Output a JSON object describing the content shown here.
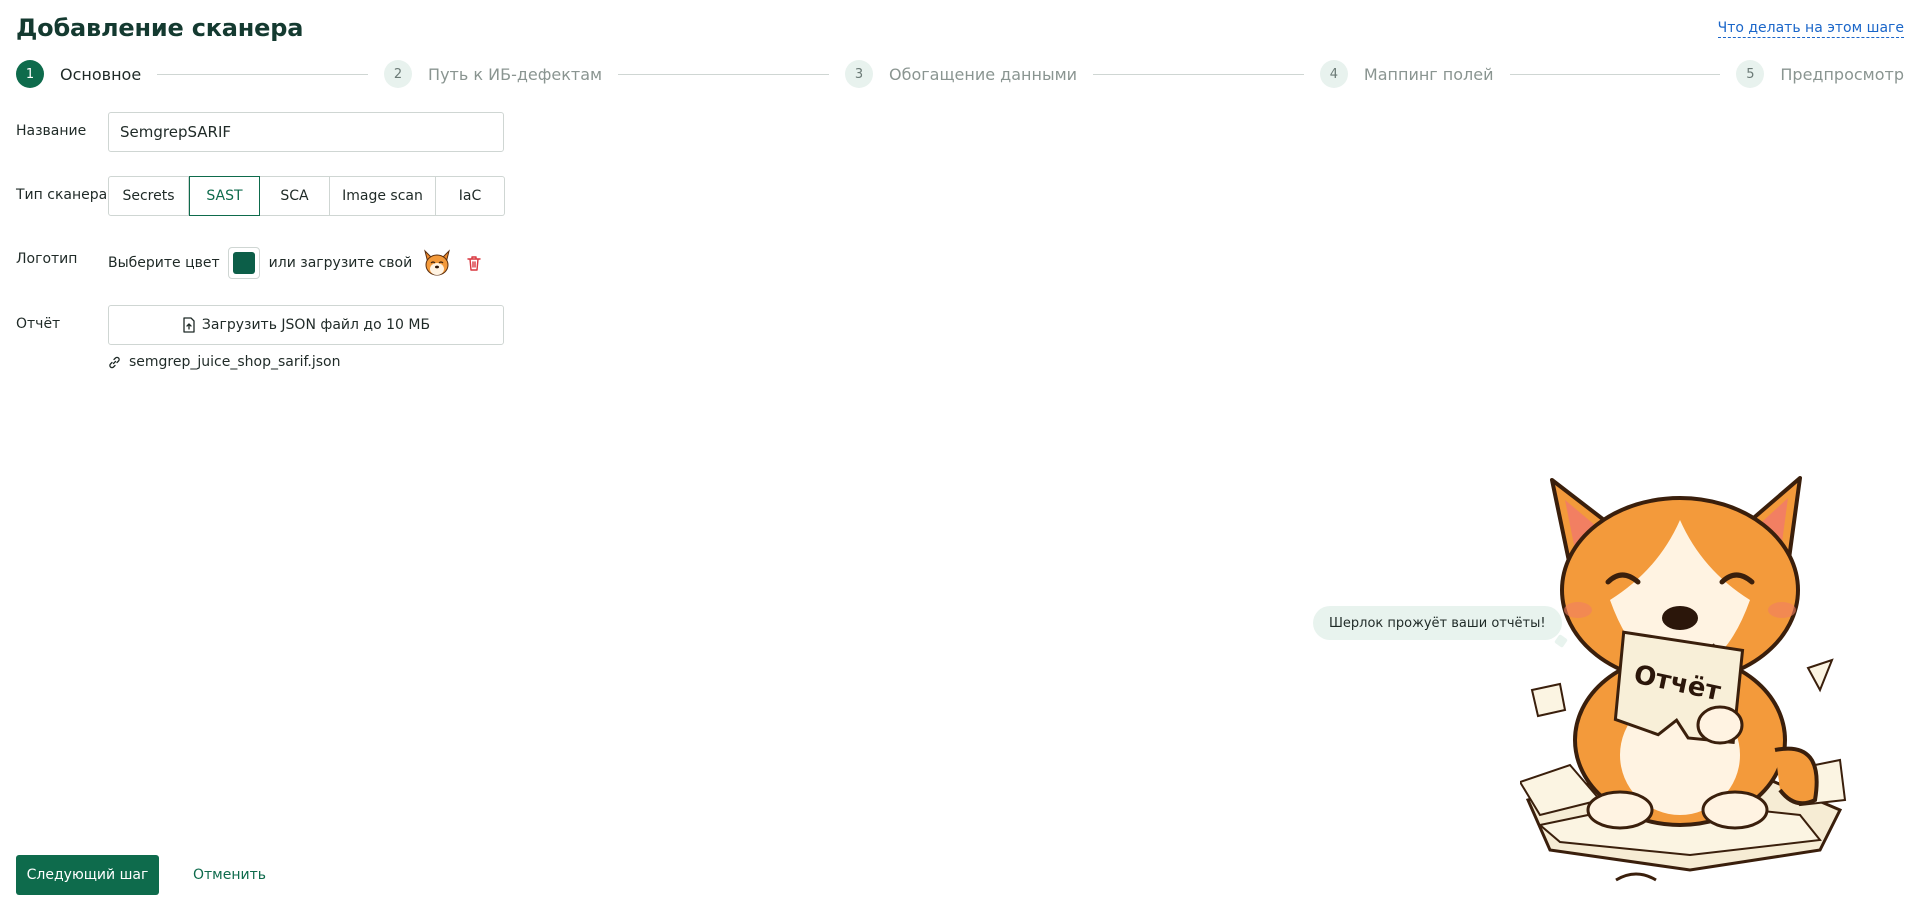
{
  "header": {
    "title": "Добавление сканера",
    "help_link": "Что делать на этом шаге"
  },
  "stepper": {
    "steps": [
      {
        "num": "1",
        "label": "Основное",
        "active": true
      },
      {
        "num": "2",
        "label": "Путь к ИБ-дефектам",
        "active": false
      },
      {
        "num": "3",
        "label": "Обогащение данными",
        "active": false
      },
      {
        "num": "4",
        "label": "Маппинг полей",
        "active": false
      },
      {
        "num": "5",
        "label": "Предпросмотр",
        "active": false
      }
    ]
  },
  "form": {
    "name_label": "Название",
    "name_value": "SemgrepSARIF",
    "type_label": "Тип сканера",
    "types": [
      {
        "label": "Secrets",
        "selected": false
      },
      {
        "label": "SAST",
        "selected": true
      },
      {
        "label": "SCA",
        "selected": false
      },
      {
        "label": "Image scan",
        "selected": false
      },
      {
        "label": "IaC",
        "selected": false
      }
    ],
    "logo_label": "Логотип",
    "logo_choose_color": "Выберите цвет",
    "logo_color": "#0c5e48",
    "logo_or_upload": "или загрузите свой",
    "report_label": "Отчёт",
    "upload_button": "Загрузить JSON файл до 10 МБ",
    "uploaded_file": "semgrep_juice_shop_sarif.json"
  },
  "actions": {
    "next": "Следующий шаг",
    "cancel": "Отменить"
  },
  "mascot": {
    "speech": "Шерлок прожуёт ваши отчёты!",
    "paper_text": "Отчёт"
  },
  "colors": {
    "accent": "#0e6b4c",
    "link": "#1a66c9",
    "danger": "#d9363e"
  }
}
